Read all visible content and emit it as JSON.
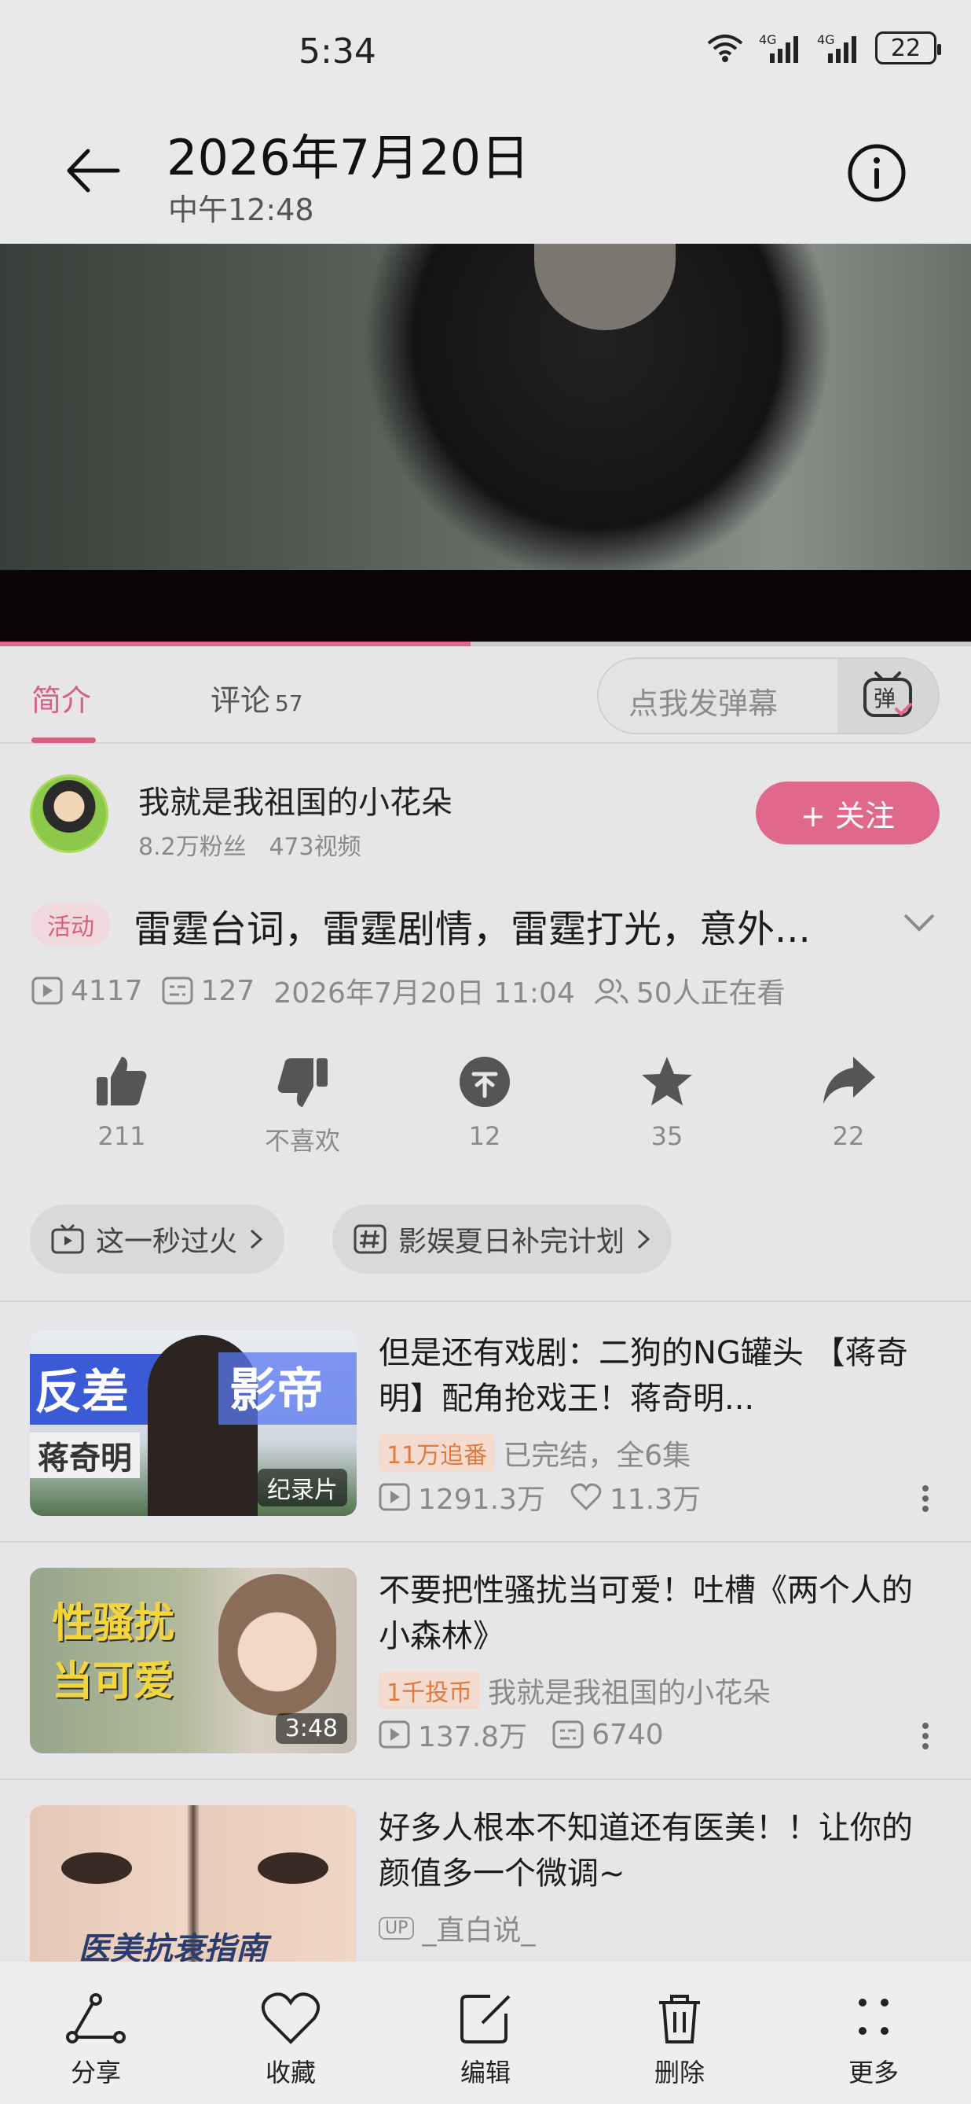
{
  "status_bar": {
    "time": "5:34",
    "battery": "22",
    "signal_label": "4G"
  },
  "gallery_header": {
    "date": "2026年7月20日",
    "time": "中午12:48"
  },
  "video": {
    "progress_percent": 48.5
  },
  "tabs": {
    "intro": "简介",
    "comments": "评论",
    "comments_count": "57"
  },
  "danmaku": {
    "placeholder": "点我发弹幕",
    "button_icon": "danmaku-icon"
  },
  "uploader": {
    "name": "我就是我祖国的小花朵",
    "fans": "8.2万粉丝",
    "videos": "473视频",
    "follow_label": "+ 关注"
  },
  "video_info": {
    "activity_badge": "活动",
    "title": "雷霆台词，雷霆剧情，雷霆打光，意外...",
    "plays": "4117",
    "danmaku_count": "127",
    "publish_time": "2026年7月20日 11:04",
    "watching": "50人正在看"
  },
  "actions": [
    {
      "icon": "thumbs-up-icon",
      "label": "211"
    },
    {
      "icon": "thumbs-down-icon",
      "label": "不喜欢"
    },
    {
      "icon": "coin-icon",
      "label": "12"
    },
    {
      "icon": "star-icon",
      "label": "35"
    },
    {
      "icon": "share-arrow-icon",
      "label": "22"
    }
  ],
  "chips": [
    {
      "icon": "tv-icon",
      "label": "这一秒过火"
    },
    {
      "icon": "hashtag-icon",
      "label": "影娱夏日补完计划"
    }
  ],
  "related": [
    {
      "title": "但是还有戏剧：二狗的NG罐头 【蒋奇明】配角抢戏王！蒋奇明...",
      "tag": "11万追番",
      "sub": "已完结，全6集",
      "stat1": "1291.3万",
      "stat2": "11.3万",
      "thumb_badge": "纪录片",
      "thumb_text_1": "反差",
      "thumb_text_2": "影帝",
      "thumb_text_3": "蒋奇明"
    },
    {
      "title": "不要把性骚扰当可爱！吐槽《两个人的小森林》",
      "tag": "1千投币",
      "sub": "我就是我祖国的小花朵",
      "stat1": "137.8万",
      "stat2": "6740",
      "thumb_badge": "3:48",
      "thumb_text_1": "性骚扰",
      "thumb_text_2": "当可爱"
    },
    {
      "title": "好多人根本不知道还有医美！！让你的颜值多一个微调~",
      "up_label": "UP",
      "sub": "_直白说_",
      "thumb_text_1": "医美抗衰指南"
    }
  ],
  "bottom_bar": [
    {
      "icon": "share-icon",
      "label": "分享"
    },
    {
      "icon": "heart-icon",
      "label": "收藏"
    },
    {
      "icon": "edit-icon",
      "label": "编辑"
    },
    {
      "icon": "trash-icon",
      "label": "删除"
    },
    {
      "icon": "more-icon",
      "label": "更多"
    }
  ],
  "colors": {
    "accent": "#e0688c",
    "background": "#e6e6e8"
  }
}
